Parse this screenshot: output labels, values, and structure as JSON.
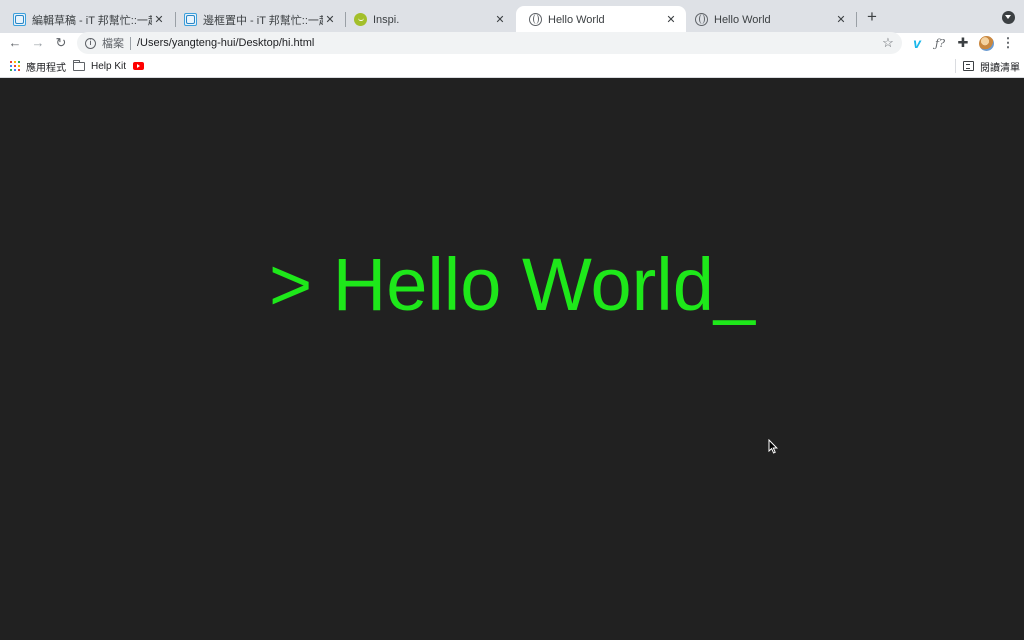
{
  "tabs": [
    {
      "title": "編輯草稿 - iT 邦幫忙::一起幫忙解",
      "favicon": "ithome-icon",
      "active": false
    },
    {
      "title": "邊框置中 - iT 邦幫忙::一起幫忙解",
      "favicon": "ithome-icon",
      "active": false
    },
    {
      "title": "Inspi.",
      "favicon": "inspi-icon",
      "active": false
    },
    {
      "title": "Hello World",
      "favicon": "globe-icon",
      "active": true
    },
    {
      "title": "Hello World",
      "favicon": "globe-icon",
      "active": false
    }
  ],
  "toolbar": {
    "scheme_label": "檔案",
    "url": "/Users/yangteng-hui/Desktop/hi.html",
    "extensions": [
      "vimeo-icon",
      "f-question-icon",
      "puzzle-icon",
      "profile-avatar"
    ]
  },
  "bookmarks": {
    "apps_label": "應用程式",
    "items": [
      {
        "label": "Help Kit",
        "icon": "folder-icon"
      },
      {
        "label": "",
        "icon": "youtube-icon"
      }
    ],
    "reading_list_label": "閱讀清單"
  },
  "page": {
    "text": "> Hello World_",
    "text_color": "#1ee81a",
    "background_color": "#212121"
  }
}
